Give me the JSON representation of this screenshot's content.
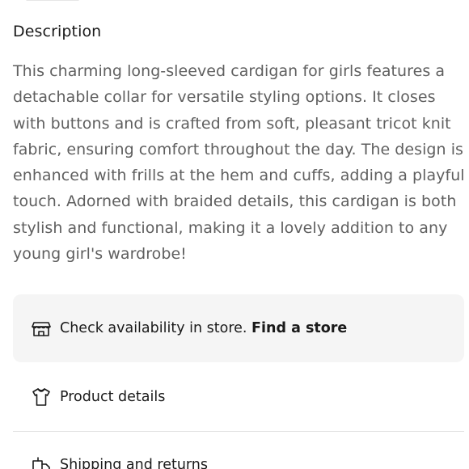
{
  "description": {
    "title": "Description",
    "body": "This charming long-sleeved cardigan for girls features a detachable collar for versatile styling options. It closes with buttons and is crafted from soft, pleasant tricot knit fabric, ensuring comfort throughout the day. The design is enhanced with frills at the hem and cuffs, adding a playful touch. Adorned with braided details, this cardigan is both stylish and functional, making it a lovely addition to any young girl's wardrobe!"
  },
  "store_availability": {
    "icon": "store-icon",
    "text": "Check availability in store.",
    "link_label": "Find a store",
    "background": "#f5f5f5"
  },
  "accordion": [
    {
      "icon": "tshirt-icon",
      "label": "Product details"
    },
    {
      "icon": "shipping-icon",
      "label": "Shipping and returns"
    }
  ],
  "colors": {
    "text_primary": "#1a1a1a",
    "text_secondary": "#5f5f5f",
    "divider": "#e3e3e3"
  }
}
